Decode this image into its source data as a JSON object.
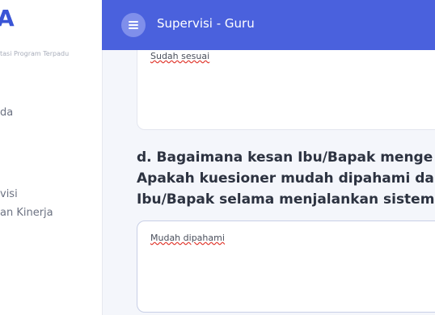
{
  "sidebar": {
    "logo": "A",
    "subtitle": "tasi Program Terpadu",
    "items": [
      {
        "label": "da"
      },
      {
        "label": "visi"
      },
      {
        "label": "an Kinerja"
      }
    ]
  },
  "header": {
    "title": "Supervisi - Guru",
    "menu_icon": "hamburger-icon"
  },
  "form": {
    "previous_answer": "Sudah sesuai",
    "question_lines": [
      "d. Bagaimana kesan Ibu/Bapak menge",
      "Apakah kuesioner mudah dipahami da",
      "Ibu/Bapak selama menjalankan sistem"
    ],
    "current_answer": "Mudah dipahami"
  },
  "colors": {
    "accent": "#4a61dd",
    "logo": "#3a55d6"
  }
}
